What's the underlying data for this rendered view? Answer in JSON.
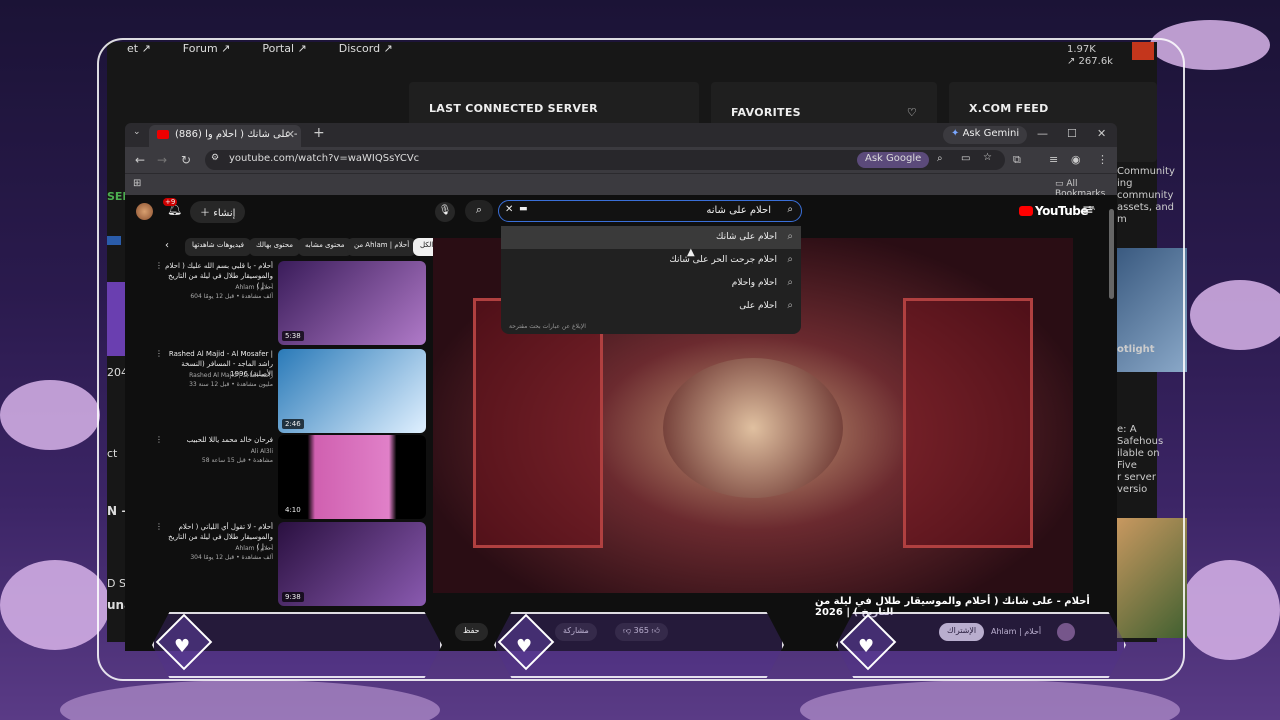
{
  "portal": {
    "top_links": [
      "et ↗",
      "Forum ↗",
      "Portal ↗",
      "Discord ↗"
    ],
    "stats": [
      "1.97K",
      "↗ 267.6k"
    ],
    "cards": [
      "LAST CONNECTED SERVER",
      "FAVORITES",
      "X.COM FEED"
    ],
    "left_fragments": [
      "SER",
      "2048",
      "ct",
      "N ➜",
      "D SER",
      "unar"
    ],
    "right_fragments": [
      "Community",
      "ing community",
      "assets, and m",
      "otlight",
      "e: A Safehous",
      "ilable on Five",
      "r server versio"
    ]
  },
  "browser": {
    "tab_title": "(886) أحلام - على شانك ( احلام وا",
    "new_tab": "+",
    "gemini_label": "Ask Gemini",
    "url": "youtube.com/watch?v=waWIQSsYCVc",
    "ask_google": "Ask Google",
    "bookmarks_label": "All Bookmarks"
  },
  "youtube": {
    "logo": "YouTube",
    "region": "SA",
    "search_value": "احلام على شانه",
    "create_label": "إنشاء",
    "notif_count": "+9",
    "suggestions": [
      "احلام على شانك",
      "احلام جرحت الحر على شانك",
      "احلام واحلام",
      "احلام على"
    ],
    "suggest_footer": "الإبلاغ عن عبارات بحث مقترحة",
    "chips": [
      "الكل",
      "من Ahlam | أحلام",
      "محتوى مشابه",
      "محتوى بهالك",
      "فيديوهات شاهدتها"
    ],
    "video_title": "أحلام - على شانك ( أحلام والموسيقار طلال في ليلة من التاريخ ) | 2026",
    "channel": "Ahlam | أحلام",
    "subscribe": "الإشتراك",
    "likes": "365",
    "share": "مشاركة",
    "save": "حفظ",
    "recos": [
      {
        "title": "أحلام - يا قلبي بسم الله عليك ( احلام والموسيقار طلال في ليلة من التاريخ ) | ...",
        "channel": "Ahlam | أحلام",
        "meta": "604 ألف مشاهدة • قبل 12 يومًا",
        "duration": "5:38"
      },
      {
        "title": "Rashed Al Majid - Al Mosafer | راشد الماجد - المسافر (النسخة الأصلية) 1996",
        "channel": "Rashed Al Majid | راشد الماجد",
        "meta": "33 مليون مشاهدة • قبل 12 سنة",
        "duration": "2:46"
      },
      {
        "title": "فرحان خالد محمد ياللا للحبيب",
        "channel": "Ali Al3li",
        "meta": "58 مشاهدة • قبل 15 ساعة",
        "duration": "4:10"
      },
      {
        "title": "أحلام - لا تقول أي اللياتي ( احلام والموسيقار طلال في ليلة من التاريخ ) | ...",
        "channel": "Ahlam | أحلام",
        "meta": "304 ألف مشاهدة • قبل 12 يومًا",
        "duration": "9:38"
      }
    ]
  },
  "colors": {
    "accent": "#3a6fd8",
    "youtube_red": "#ff0000",
    "hud_border": "#ffffff"
  },
  "icons": [
    "heart-icon",
    "search-icon",
    "mic-icon",
    "bell-icon",
    "close-icon",
    "menu-icon"
  ]
}
